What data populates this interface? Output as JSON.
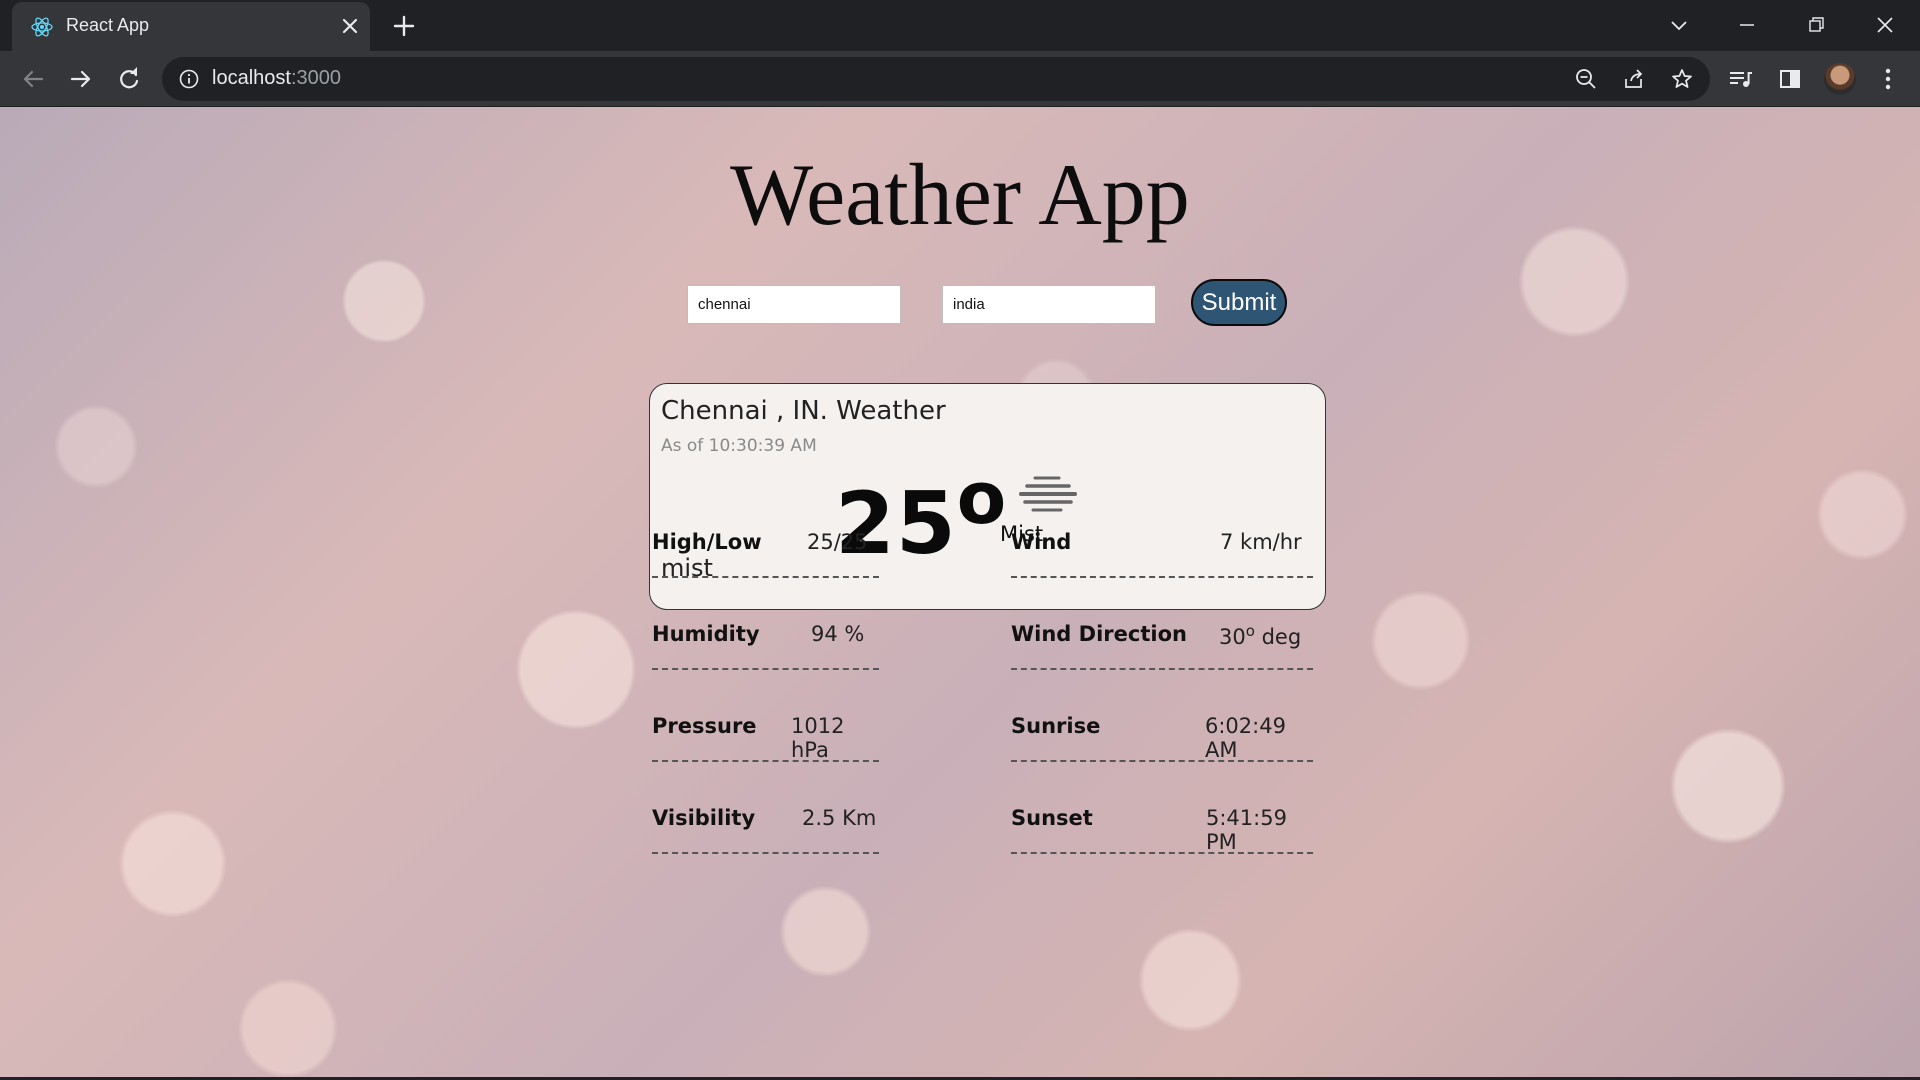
{
  "browser": {
    "tab_title": "React App",
    "url_host": "localhost",
    "url_port": ":3000"
  },
  "app": {
    "title": "Weather App",
    "city_input_value": "chennai",
    "country_input_value": "india",
    "submit_label": "Submit"
  },
  "card": {
    "location": "Chennai , IN. Weather",
    "as_of": "As of 10:30:39 AM",
    "temperature": "25",
    "degree": "o",
    "condition": "Mist",
    "description": "mist",
    "icon": "mist-icon"
  },
  "details": {
    "left": [
      {
        "label": "High/Low",
        "value": "25/25"
      },
      {
        "label": "Humidity",
        "value": "94 %"
      },
      {
        "label": "Pressure",
        "value": "1012 hPa"
      },
      {
        "label": "Visibility",
        "value": "2.5 Km"
      }
    ],
    "right": [
      {
        "label": "Wind",
        "value": "7 km/hr"
      },
      {
        "label": "Wind Direction",
        "value_num": "30",
        "value_sup": "o",
        "value_unit": " deg"
      },
      {
        "label": "Sunrise",
        "value": "6:02:49 AM"
      },
      {
        "label": "Sunset",
        "value": "5:41:59 PM"
      }
    ]
  },
  "colors": {
    "submit_bg": "#2f5574",
    "card_bg": "#f4f1ef",
    "chrome_dark": "#202124",
    "chrome_toolbar": "#35363a"
  }
}
